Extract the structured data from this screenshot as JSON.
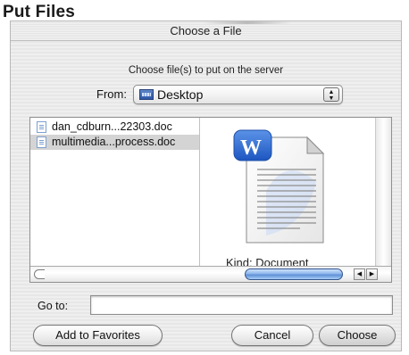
{
  "page": {
    "heading": "Put Files"
  },
  "dialog": {
    "title": "Choose a File",
    "prompt": "Choose file(s) to put on the server",
    "from": {
      "label": "From:",
      "value": "Desktop",
      "icon": "desktop-disk-icon"
    },
    "files": [
      {
        "name": "dan_cdburn...22303.doc",
        "selected": false,
        "icon": "doc-icon"
      },
      {
        "name": "multimedia...process.doc",
        "selected": true,
        "icon": "doc-icon"
      }
    ],
    "preview": {
      "caption": "Kind: Document",
      "icon": "word-document-icon"
    },
    "goto": {
      "label": "Go to:",
      "value": ""
    },
    "buttons": {
      "add_to_favorites": "Add to Favorites",
      "cancel": "Cancel",
      "choose": "Choose"
    },
    "scroll": {
      "left_arrow": "◀",
      "right_arrow": "▶"
    }
  },
  "colors": {
    "selection": "#d4d4d4",
    "scroll_thumb": "#5d8fd6",
    "word_blue": "#2f6fd6"
  }
}
